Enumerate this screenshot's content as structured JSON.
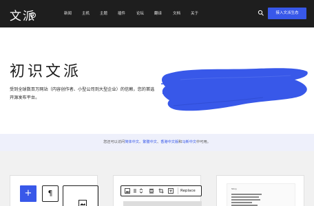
{
  "header": {
    "logo_text": "文派",
    "logo_badge": "®",
    "nav": [
      "新闻",
      "主机",
      "主题",
      "插件",
      "论坛",
      "翻译",
      "文档",
      "关于"
    ],
    "search_icon": "search-icon",
    "cta_label": "接入文派生态"
  },
  "hero": {
    "title": "初识文派",
    "description": "受到全球数百万网站（内容创作者、小型公司到大型企业）的信赖，您的首选开源发布平台。",
    "brush_color": "#3858e9"
  },
  "banner": {
    "prefix": "您还可以访问",
    "link1": "简体中文",
    "sep1": "、",
    "link2": "繁體中文",
    "sep2": "、",
    "link3": "香港中文版",
    "mid": "和",
    "link4": "马新中文",
    "suffix": "中可用。"
  },
  "cards": {
    "card1": {
      "plus_label": "+",
      "paragraph_label": "¶",
      "image_icon": "image-icon"
    },
    "card2": {
      "replace_label": "Replace"
    },
    "card3": {
      "mini_title": "Story"
    }
  },
  "colors": {
    "accent": "#3858e9",
    "header_bg": "#1e1e1e",
    "banner_bg": "#eef0fb"
  }
}
